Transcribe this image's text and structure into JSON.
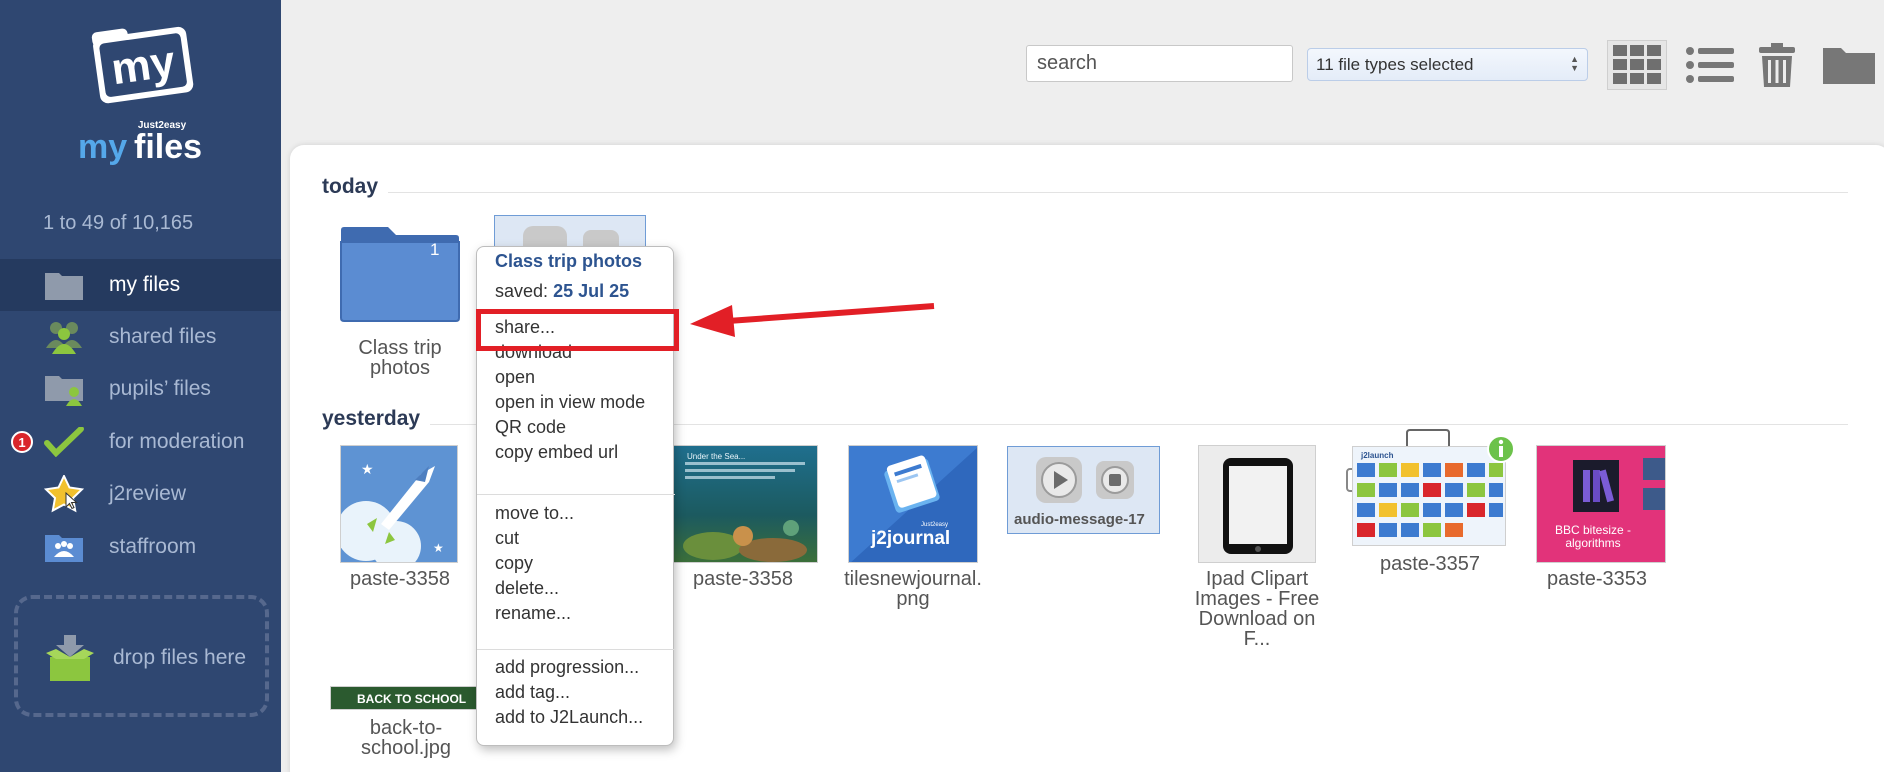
{
  "sidebar": {
    "logo_top": "my",
    "logo_brand": "Just2easy",
    "logo_bottom_my": "my",
    "logo_bottom_files": "files",
    "file_count": "1 to 49 of 10,165",
    "nav": [
      {
        "label": "my files",
        "icon": "folder-icon",
        "active": true
      },
      {
        "label": "shared files",
        "icon": "group-icon"
      },
      {
        "label": "pupils’ files",
        "icon": "pupil-folder-icon"
      },
      {
        "label": "for moderation",
        "icon": "checkmark-icon",
        "badge": "1"
      },
      {
        "label": "j2review",
        "icon": "star-icon"
      },
      {
        "label": "staffroom",
        "icon": "staff-folder-icon"
      }
    ],
    "drop_label": "drop files here"
  },
  "toolbar": {
    "search_placeholder": "search",
    "file_types": "11 file types selected",
    "icons": [
      "grid-view-icon",
      "list-view-icon",
      "trash-icon",
      "new-folder-icon"
    ]
  },
  "sections": {
    "today": "today",
    "yesterday": "yesterday"
  },
  "files": {
    "class_trip": {
      "label": "Class trip photos",
      "count": "1"
    },
    "paste3358a": {
      "label": "paste-3358"
    },
    "paste3358b": {
      "label": "paste-3358",
      "thumb_text": "Under the Sea..."
    },
    "tiles": {
      "label": "tilesnewjournal.png",
      "thumb_brand": "Just2easy",
      "thumb_text": "j2journal"
    },
    "audio": {
      "label": "audio-message-17"
    },
    "ipad": {
      "label": "Ipad Clipart Images - Free Download on F..."
    },
    "paste3357": {
      "label": "paste-3357",
      "thumb_text": "j2launch"
    },
    "paste3353": {
      "label": "paste-3353",
      "thumb_text": "BBC bitesize - algorithms"
    },
    "school": {
      "label": "back-to-school.jpg",
      "thumb_text": "BACK TO SCHOOL"
    }
  },
  "menu": {
    "title": "Class trip photos",
    "saved_label": "saved:",
    "saved_date": "25 Jul 25",
    "groups": [
      [
        "share...",
        "download",
        "open",
        "open in view mode",
        "QR code",
        "copy embed url"
      ],
      [
        "move to...",
        "cut",
        "copy",
        "delete...",
        "rename..."
      ],
      [
        "add progression...",
        "add tag...",
        "add to J2Launch..."
      ]
    ]
  },
  "colors": {
    "sidebar": "#2f4771",
    "accent": "#2d5490",
    "highlight": "#e21f26",
    "folder": "#5b8cd2"
  }
}
